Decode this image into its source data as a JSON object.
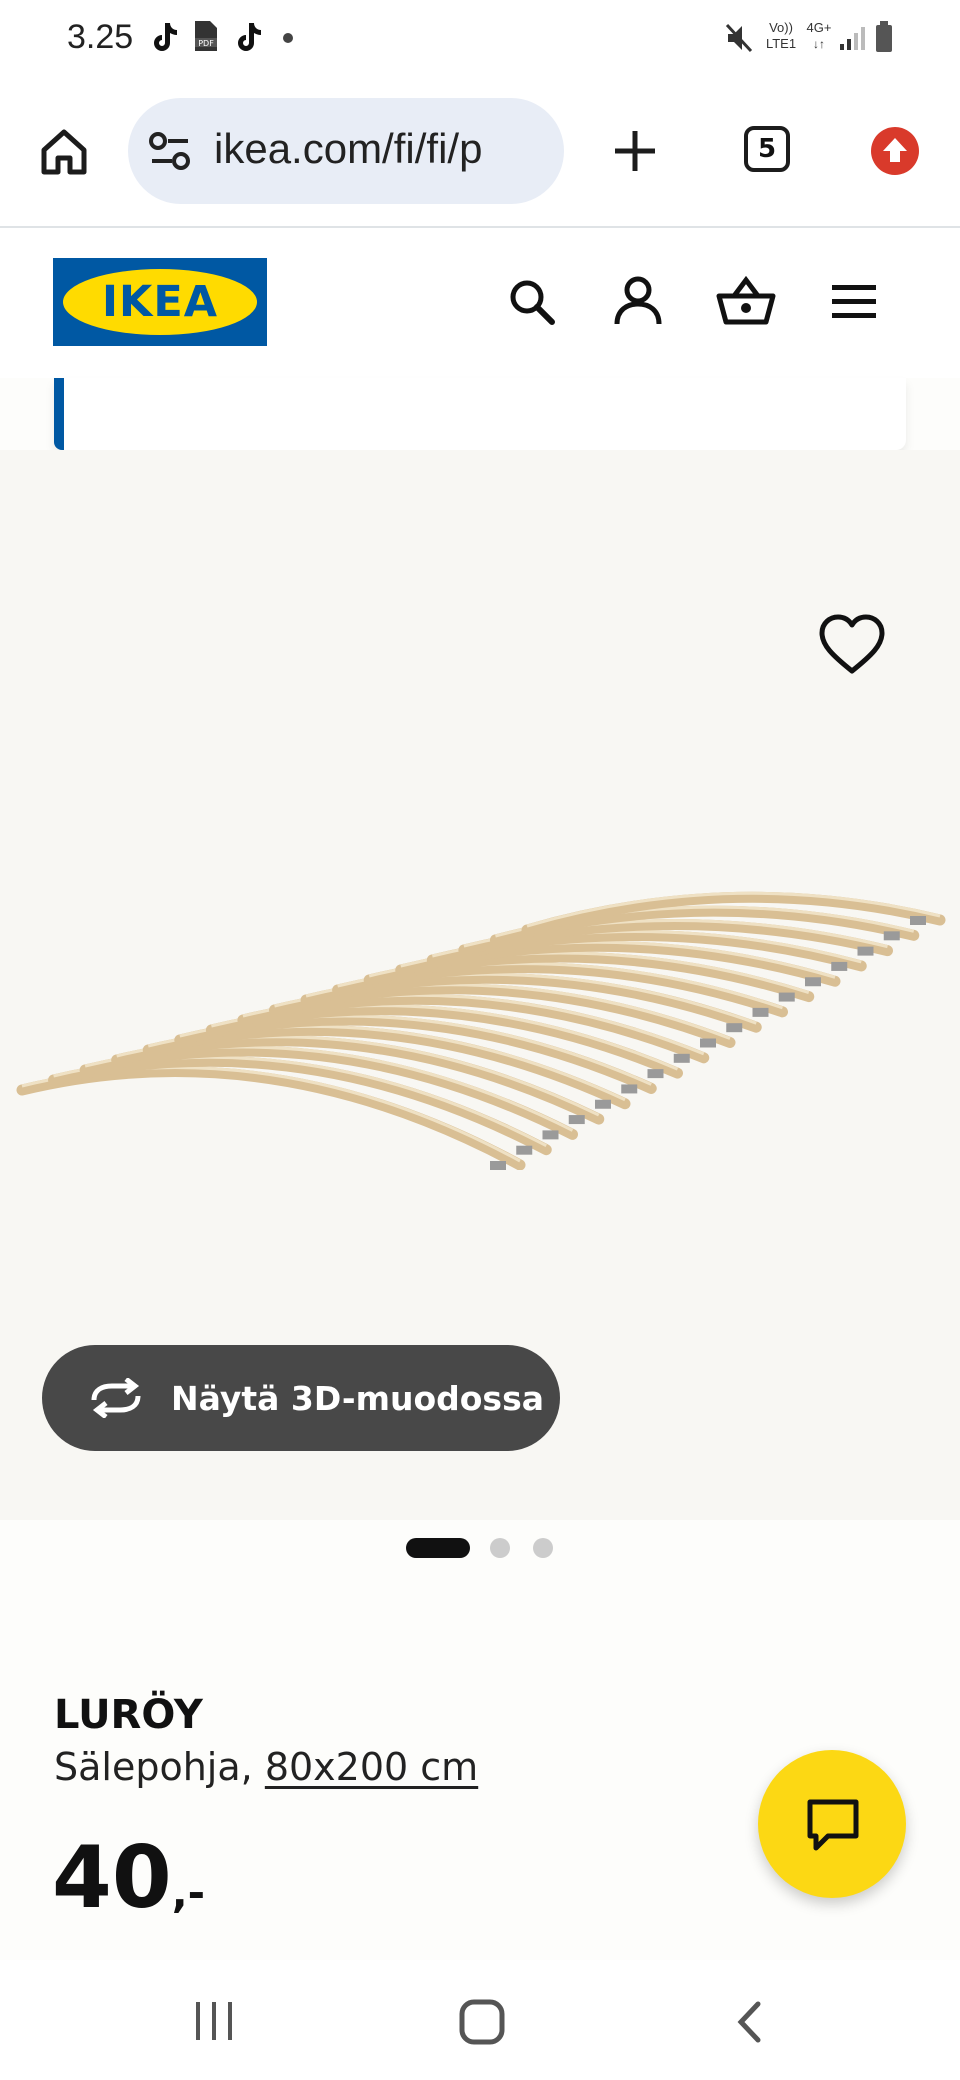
{
  "status_bar": {
    "time": "3.25",
    "network_top": "Vo))",
    "network_bottom": "LTE1",
    "network_type": "4G+",
    "icons": [
      "tiktok-icon",
      "pdf-icon",
      "tiktok-icon",
      "dot-icon",
      "mute-icon",
      "signal-icon",
      "battery-icon"
    ]
  },
  "browser": {
    "url": "ikea.com/fi/fi/p",
    "tab_count": "5",
    "icons": [
      "home-icon",
      "site-settings-icon",
      "new-tab-icon",
      "tab-switcher-icon",
      "update-icon"
    ]
  },
  "header": {
    "logo_text": "IKEA",
    "icons": [
      "search-icon",
      "account-icon",
      "basket-icon",
      "menu-icon"
    ]
  },
  "gallery": {
    "view_3d_label": "Näytä 3D-muodossa",
    "active_index": 0,
    "image_count": 3
  },
  "product": {
    "name": "LURÖY",
    "type": "Sälepohja,",
    "size": "80x200 cm",
    "price_int": "40",
    "price_dec": ",-"
  },
  "colors": {
    "ikea_blue": "#0058a3",
    "ikea_yellow": "#fcd814",
    "button_dark": "#484848",
    "update_red": "#d93a2b"
  }
}
